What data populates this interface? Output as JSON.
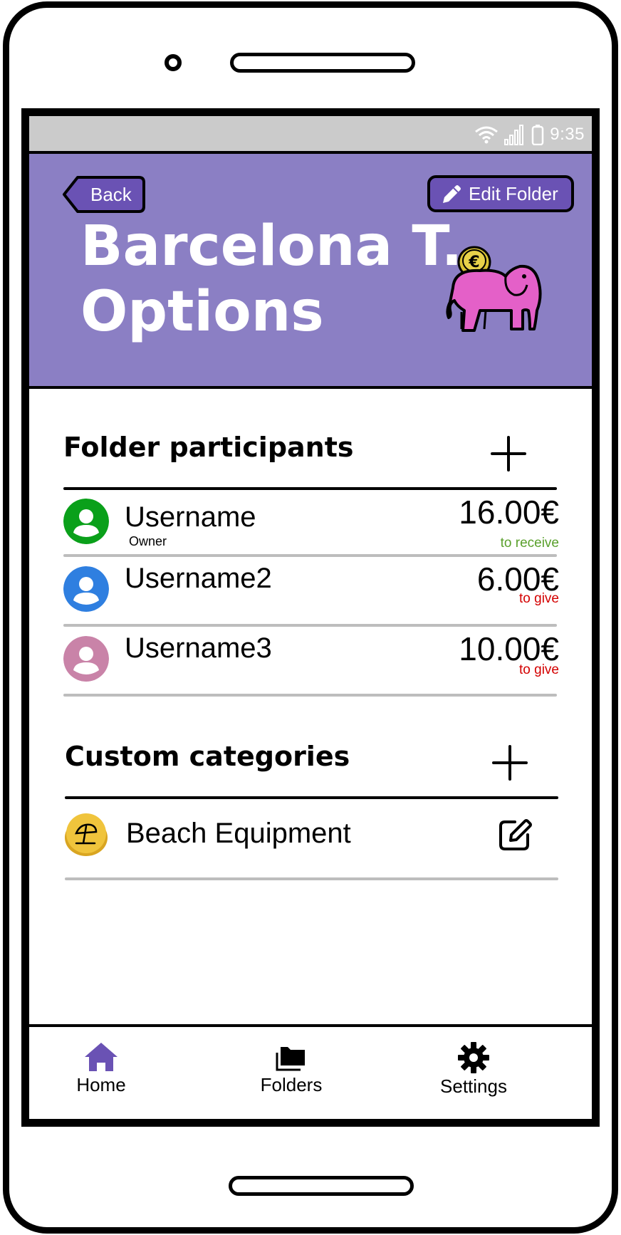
{
  "status_bar": {
    "time": "9:35",
    "icons": [
      "wifi-icon",
      "signal-icon",
      "battery-icon"
    ]
  },
  "header": {
    "back_label": "Back",
    "edit_label": "Edit Folder",
    "title_line1": "Barcelona T...",
    "title_line2": "Options",
    "mascot": "piggy-bank-elephant-icon"
  },
  "participants": {
    "title": "Folder participants",
    "items": [
      {
        "name": "Username",
        "role": "Owner",
        "amount": "16.00€",
        "status": "to receive",
        "avatar_color": "#0aa01a",
        "status_color": "#5aa02c"
      },
      {
        "name": "Username2",
        "role": "",
        "amount": "6.00€",
        "status": "to give",
        "avatar_color": "#2f7fe0",
        "status_color": "#d40000"
      },
      {
        "name": "Username3",
        "role": "",
        "amount": "10.00€",
        "status": "to give",
        "avatar_color": "#c983a8",
        "status_color": "#d40000"
      }
    ]
  },
  "categories": {
    "title": "Custom categories",
    "items": [
      {
        "name": "Beach Equipment",
        "icon": "beach-umbrella-icon",
        "icon_color": "#e8b92a"
      }
    ]
  },
  "nav": {
    "items": [
      {
        "label": "Home",
        "icon": "home-icon",
        "active": true,
        "color": "#6a52b4"
      },
      {
        "label": "Folders",
        "icon": "folder-icon",
        "active": false
      },
      {
        "label": "Settings",
        "icon": "gear-icon",
        "active": false
      }
    ]
  },
  "colors": {
    "header_bg": "#8b7fc4",
    "button_bg": "#6a52b4",
    "status_bar": "#cbcbcb"
  }
}
